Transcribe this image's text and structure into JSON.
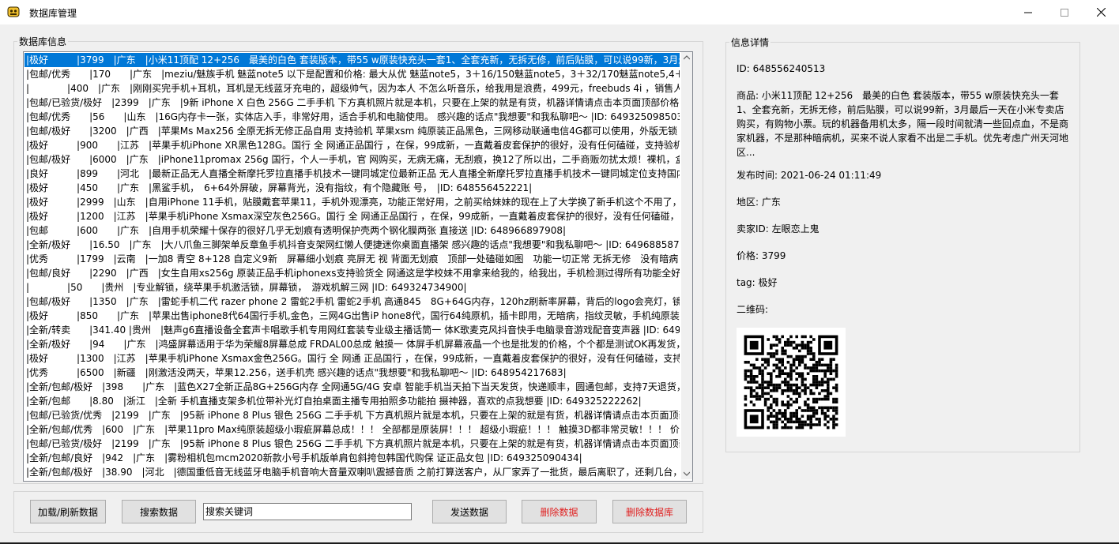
{
  "window": {
    "title": "数据库管理",
    "app_icon": "database-app-icon",
    "controls": [
      "minimize-icon",
      "maximize-icon",
      "close-icon"
    ]
  },
  "db_group": {
    "legend": "数据库信息",
    "rows": [
      "|极好　　　|3799　|广东　|小米11顶配 12+256　最美的白色 套装版本，带55 w原装快充头一套1、全套充新，无拆无修，前后贴膜，可以说99新，3月最后一",
      "|包邮/优秀　　|170　　|广东　|meziu/魅族手机 魅蓝note5 以下是配置和价格: 最大从优 魅蓝note5，3＋16/150魅蓝note5，3＋32/170魅蓝note5,4＋64/22",
      "|　　　　|400　|广东　|刚刚买完手机+耳机，耳机是无线蓝牙充电的，超级帅气，因为本人 不怎么听音乐，给我用是浪费，499元，freebuds 4i ，销售人员说",
      "|包邮/已验货/极好　|2399　|广东　|9新 iPhone X 白色 256G 二手手机 下方真机照片就是本机，只要在上架的就是有货，机器详情请点击本页面顶部价格下的",
      "|包邮/优秀　　|56　　|山东　|16G内存卡一张，实体店入手，非常好用，适合手机和电脑使用。 感兴趣的话点\"我想要\"和我私聊吧～ |ID: 649325098503|",
      "|包邮/极好　　|3200　|广西　|苹果Ms Max256 全原无拆无修正品自用 支持验机 苹果xsm 纯原装正品黑色，三网移动联通电信4G都可以使用，外版无锁 单卡",
      "|极好　　　|900　　|江苏　|苹果手机iPhone XR黑色128G。国行 全 网通正品国行 ，在保，99成新，一直戴着皮套保护的很好，没有任何磕碰，支持验机，同",
      "|包邮/极好　　|6000　|广东　|iPhone11promax 256g 国行，个人一手机，官 网购买，无病无痛，无刮痕，换12了所以出，二手商贩勿扰太烦！裸机，盒子扔",
      "|良好　　　|899　　|河北　|最新正品无人直播全新摩托罗拉直播手机技术一键同城定位最新正品 无人直播全新摩托罗拉直播手机技术一键同城定位支持国内999",
      "|极好　　　|450　　|广东　|黑鲨手机，　6+64外屏破，屏幕背光，没有指纹，有个隐藏账 号，　|ID: 648556452221|",
      "|极好　　　|2999　|山东　|自用iPhone 11手机，贴膜戴套苹果11，手机外观漂亮，功能正常好用，之前买给妹妹的现在上了大学换了新手机这个不用了，闲置",
      "|极好　　　|1200　|江苏　|苹果手机iPhone Xsmax深空灰色256G。国行 全 网通正品国行 ，在保，99成新，一直戴着皮套保护的很好，没有任何磕碰，支持验",
      "|包邮　　　|600　　|广东　|自用手机荣耀十保存的很好几乎无划痕有透明保护壳两个钢化膜两张 直接送 |ID: 648966897908|",
      "|全新/极好　　|16.50　|广东　|大八爪鱼三脚架单反章鱼手机抖音支架网红懒人便捷迷你桌面直播架 感兴趣的话点\"我想要\"和我私聊吧～ |ID: 649688587734|",
      "|优秀　　　|1799　|云南　|一加8 青空 8+128 自定义9新　屏幕细小划痕 亮屏无 视 背面无划痕　顶部一处磕碰如图　功能一切正常 无拆无修　没有暗病　单机加",
      "|包邮/良好　　|2290　|广西　|女生自用xs256g 原装正品手机iphonexs支持验货全 网通这是学校妹不用拿来给我的，给我出，手机检测过得所有功能全好，",
      "|　　　　|50　　|贵州　|专业解锁，绕苹果手机激活锁，屏幕锁，　游戏机解三网 |ID: 649324734900|",
      "|包邮/极好　　|1350　|广东　|雷蛇手机二代 razer phone 2 雷蛇2手机 雷蛇2手机 高通845　8G+64G内存，120hz刷新率屏幕，背后的logo会亮灯，镜面黑，",
      "|极好　　　|850　　|广东　|苹果出售iphone8代64国行手机,金色，三网4G出售iP hone8代，国行64纯原机，插卡即用，无暗病，指纹灵敏，手机纯原装无任何",
      "|全新/转卖　　|341.40 |贵州　|魅声g6直播设备全套声卡唱歌手机专用网红套装专业级主播话筒一 体K歌麦克风抖音快手电脑录音游戏配音变声器 |ID: 6496891",
      "|全新/极好　　|94　　|广东　|鸿盛屏幕适用于华为荣耀8屏幕总成 FRDAL00总成 触摸一 体屏手机屏幕液晶一个也是批发的价格，个个都是测试OK再发货，型号",
      "|极好　　　|1300　|江苏　|苹果手机iPhone Xsmax金色256G。国行 全 网通 正品国行 ，在保，99成新，一直戴着皮套保护的很好，没有任何磕碰，支持验机",
      "|优秀　　　|6500　|新疆　|刚激活没两天，苹果12.256，送手机壳 感兴趣的话点\"我想要\"和我私聊吧～ |ID: 648954217683|",
      "|全新/包邮/极好　|398　　|广东　|蓝色X27全新正品8G+256G内存 全网通5G/4G 安卓 智能手机当天拍下当天发货，快递顺丰，圆通包邮，支持7天退货，保修",
      "|全新/包邮　　|8.80　|浙江　|全新 手机直播支架多机位带补光灯自拍桌面主播专用拍照多功能拍 摄神器，喜欢的点我想要 |ID: 649325222262|",
      "|包邮/已验货/优秀　|2199　|广东　|95新 iPhone 8 Plus 银色 256G 二手手机 下方真机照片就是本机，只要在上架的就是有货，机器详情请点击本页面顶部价格",
      "|全新/包邮/优秀　|600　|广东　|苹果11pro Max纯原装超级小瑕疵屏幕总成！！！ 全部都是原装屏！！！ 超级小瑕疵！！！ 触摸3D都非常灵敏！！！ 价格实",
      "|包邮/已验货/极好　|2199　|广东　|95新 iPhone 8 Plus 银色 256G 二手手机 下方真机照片就是本机，只要在上架的就是有货，机器详情请点击本页面顶部价格",
      "|全新/包邮/良好　|942　|广东　|雾粉相机包mcm2020新款小号手机版单肩包斜挎包韩国代购保 证正品女包 |ID: 649325090434|",
      "|全新/包邮/极好　|38.90　|河北　|德国重低音无线蓝牙电脑手机音响大音量双喇叭震撼音质 之前打算送客户，从厂家弄了一批货，最后离职了，还剩几台，都是"
    ]
  },
  "actions": {
    "load_label": "加载/刷新数据",
    "search_label": "搜索数据",
    "search_value": "搜索关键词",
    "send_label": "发送数据",
    "delete_label": "删除数据",
    "delete_db_label": "删除数据库",
    "danger_color": "#e02020"
  },
  "detail": {
    "legend": "信息详情",
    "id": "ID: 648556240513",
    "product": "商品: 小米11顶配 12+256　最美的白色 套装版本，带55 w原装快充头一套1、全套充新，无拆无修，前后贴膜，可以说99新，3月最后一天在小米专卖店购买，有购物小票。玩的机器备用机太多，隔一段时间就清一些回点血，不是商家机器，不是那种暗病机，买来不说人家看不出是二手机。优先考虑广州天河地区...",
    "publish_time": "发布时间: 2021-06-24 01:11:49",
    "region": "地区: 广东",
    "seller": "卖家ID: 左眼恋上鬼",
    "price": "价格: 3799",
    "tag": "tag: 极好",
    "qr_label": "二维码:",
    "qr_icon": "qr-code-image"
  },
  "colors": {
    "selection": "#0078d7",
    "danger": "#e02020"
  }
}
